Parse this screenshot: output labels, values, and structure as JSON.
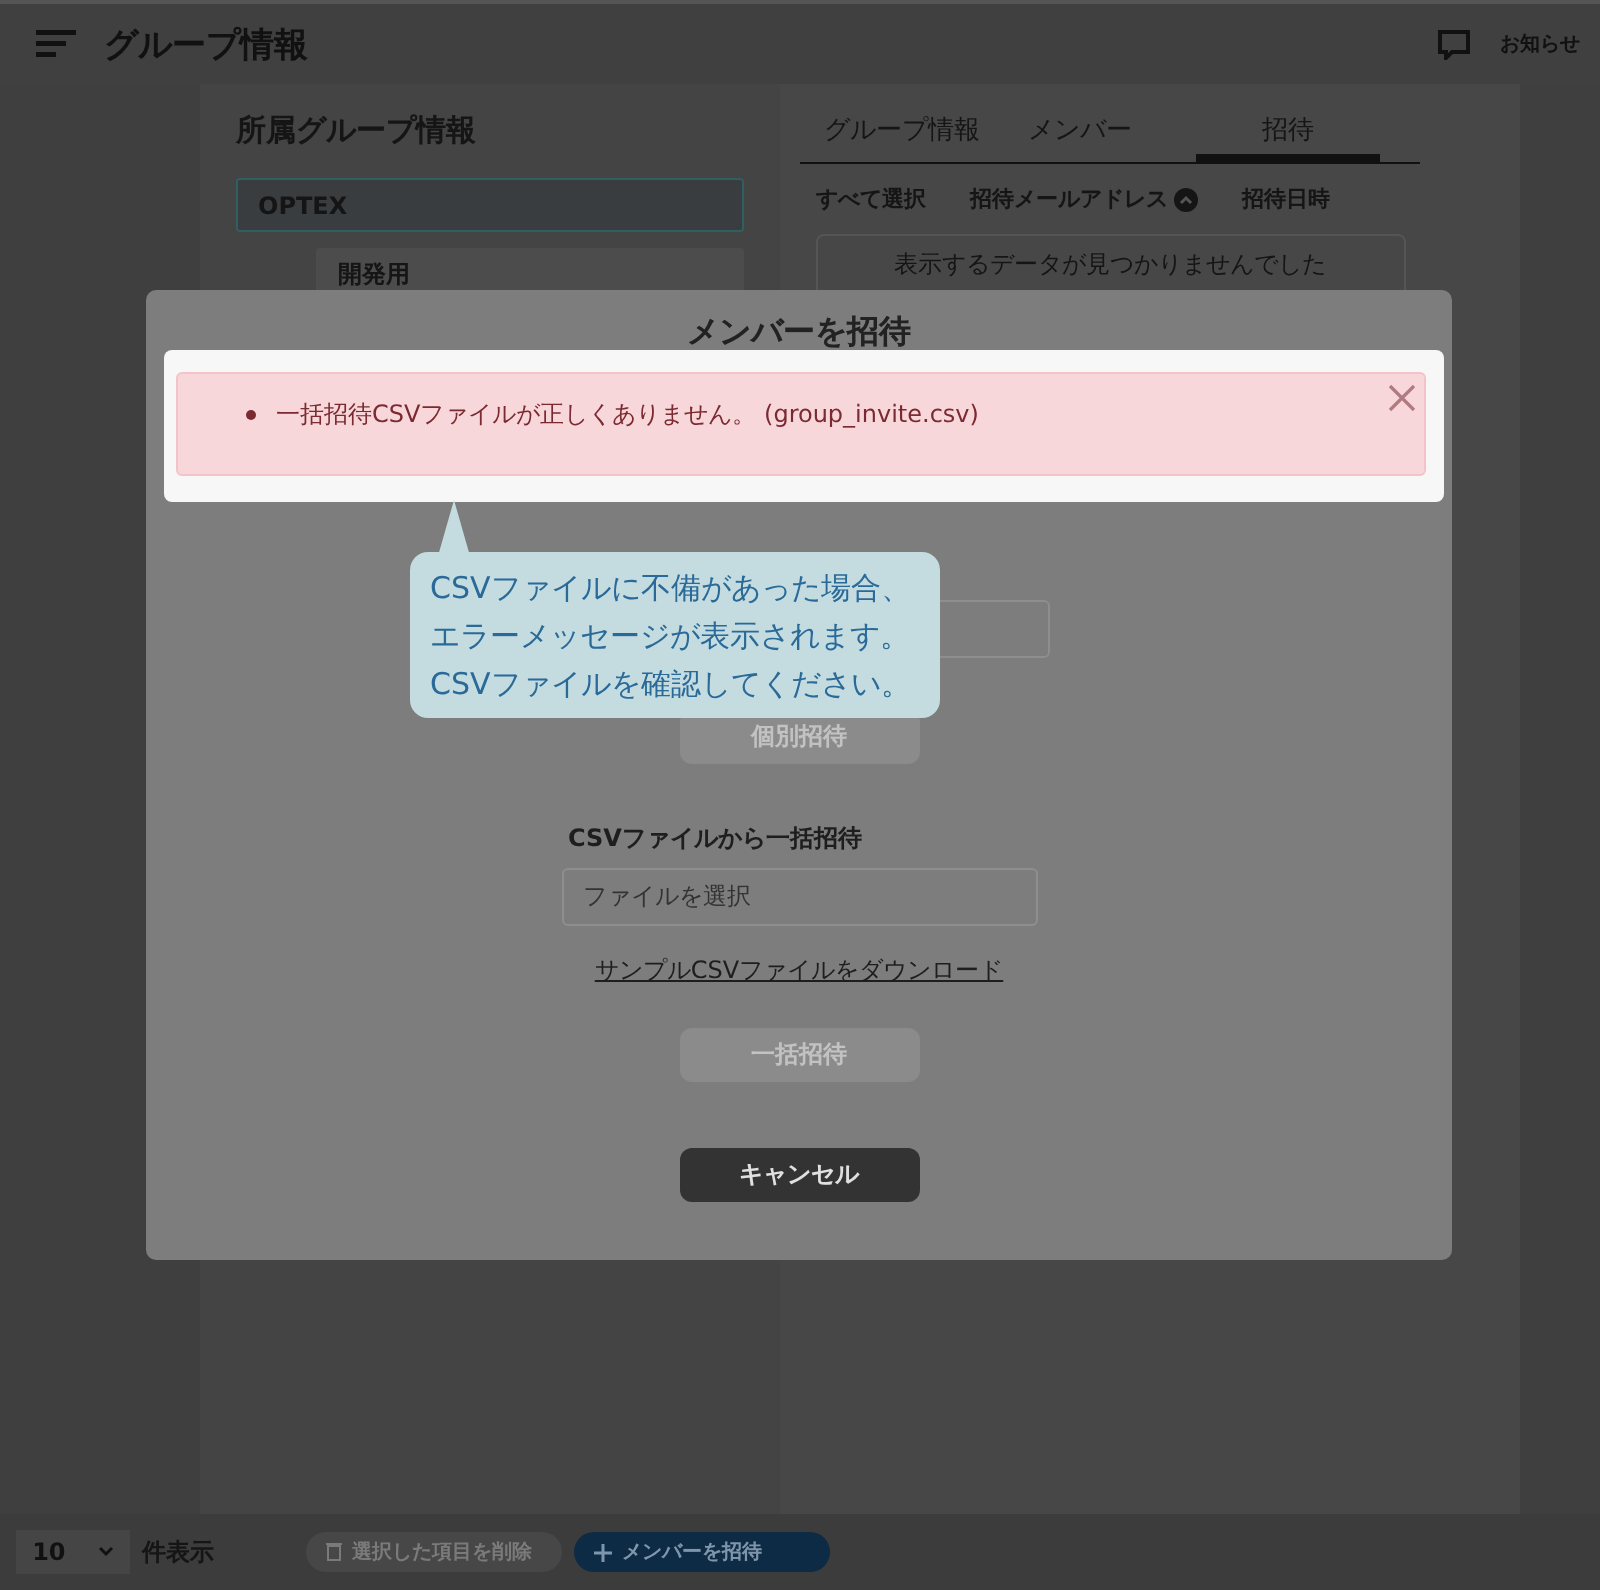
{
  "header": {
    "title": "グループ情報",
    "notice": "お知らせ"
  },
  "sidebar": {
    "title": "所属グループ情報",
    "groups": [
      {
        "name": "OPTEX",
        "selected": true,
        "children": [
          {
            "name": "開発用",
            "selected": false
          }
        ]
      }
    ]
  },
  "tabs": [
    {
      "label": "グループ情報",
      "selected": false
    },
    {
      "label": "メンバー",
      "selected": false
    },
    {
      "label": "招待",
      "selected": true
    }
  ],
  "table": {
    "columns": [
      {
        "label": "すべて選択",
        "sorted": false
      },
      {
        "label": "招待メールアドレス",
        "sorted": true
      },
      {
        "label": "招待日時",
        "sorted": false
      }
    ],
    "empty": "表示するデータが見つかりませんでした"
  },
  "footer": {
    "page_size": "10",
    "page_size_label": "件表示",
    "buttons": [
      {
        "label": "選択した項目を削除",
        "kind": "delete",
        "disabled": true
      },
      {
        "label": "メンバーを招待",
        "kind": "add",
        "disabled": false
      }
    ]
  },
  "modal": {
    "title": "メンバーを招待",
    "alert": "一括招待CSVファイルが正しくありません。 (group_invite.csv)",
    "individual_button": {
      "label": "個別招待",
      "disabled": true
    },
    "csv_label": "CSVファイルから一括招待",
    "file_placeholder": "ファイルを選択",
    "sample_link": "サンプルCSVファイルをダウンロード",
    "bulk_button": {
      "label": "一括招待",
      "disabled": true
    },
    "cancel": "キャンセル"
  },
  "callout": {
    "lines": [
      "CSVファイルに不備があった場合、",
      "エラーメッセージが表示されます。",
      "CSVファイルを確認してください。"
    ]
  }
}
